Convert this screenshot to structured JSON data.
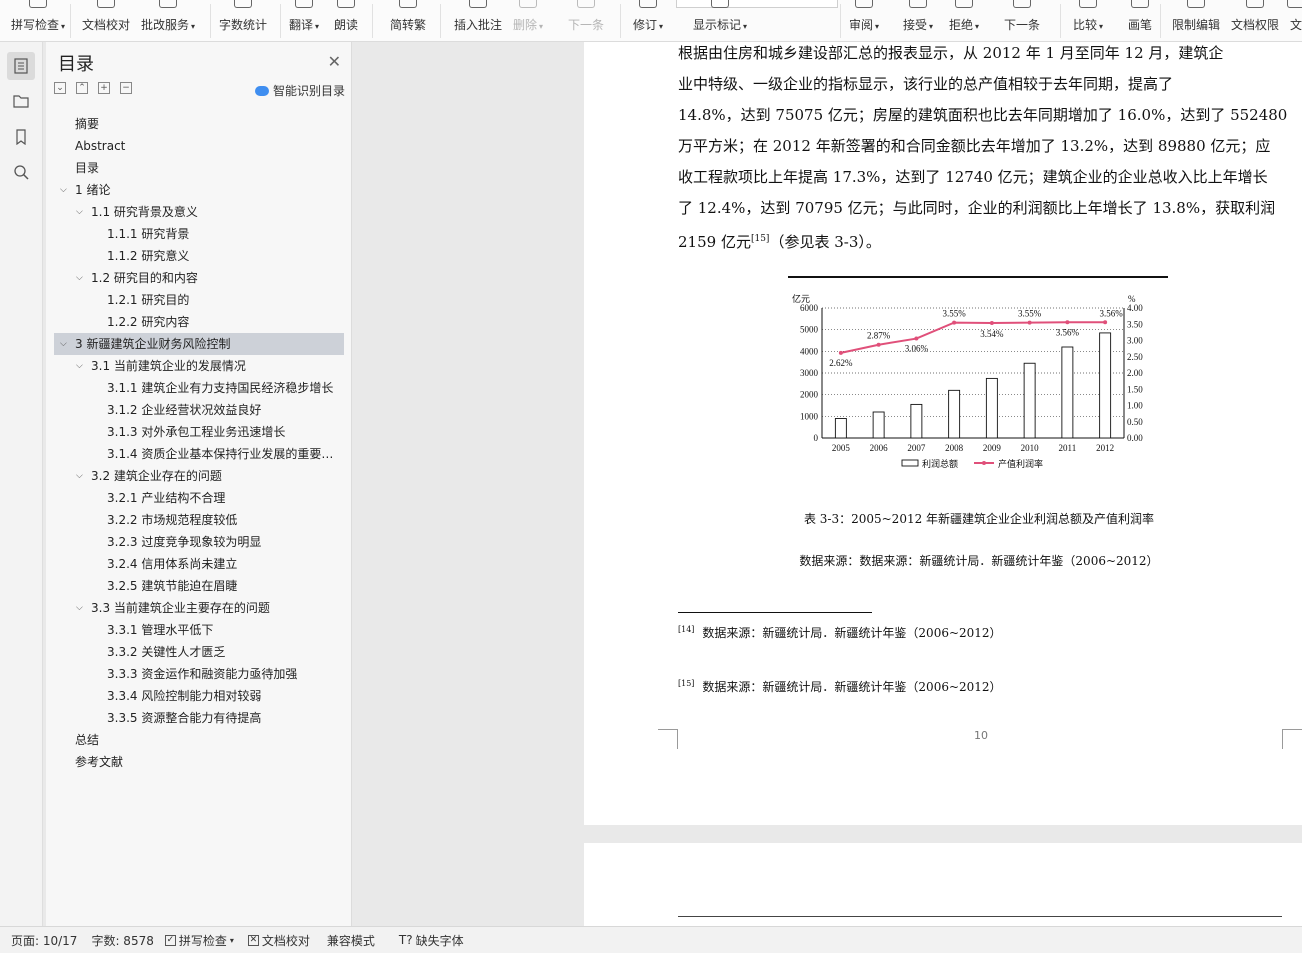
{
  "ribbon": {
    "items": [
      {
        "label": "拼写检查",
        "caret": true
      },
      {
        "label": "文档校对",
        "caret": false
      },
      {
        "label": "批改服务",
        "caret": true
      },
      {
        "label": "字数统计",
        "caret": false
      },
      {
        "label": "翻译",
        "caret": true
      },
      {
        "label": "朗读",
        "caret": false
      },
      {
        "label": "简转繁",
        "caret": false
      },
      {
        "label": "插入批注",
        "caret": false
      },
      {
        "label": "删除",
        "caret": true
      },
      {
        "label": "下一条",
        "caret": false
      },
      {
        "label": "修订",
        "caret": true
      },
      {
        "label": "显示标记",
        "caret": true
      },
      {
        "label": "审阅",
        "caret": true
      },
      {
        "label": "接受",
        "caret": true
      },
      {
        "label": "拒绝",
        "caret": true
      },
      {
        "label": "下一条",
        "caret": false
      },
      {
        "label": "比较",
        "caret": true
      },
      {
        "label": "画笔",
        "caret": false
      },
      {
        "label": "限制编辑",
        "caret": false
      },
      {
        "label": "文档权限",
        "caret": false
      },
      {
        "label": "文",
        "caret": false
      }
    ]
  },
  "toc": {
    "title": "目录",
    "smart_label": "智能识别目录",
    "items": [
      {
        "text": "摘要",
        "level": 0,
        "arrow": false
      },
      {
        "text": "Abstract",
        "level": 0,
        "arrow": false
      },
      {
        "text": "目录",
        "level": 0,
        "arrow": false
      },
      {
        "text": "1  绪论",
        "level": 1,
        "arrow": true
      },
      {
        "text": "1.1  研究背景及意义",
        "level": 2,
        "arrow": true
      },
      {
        "text": "1.1.1 研究背景",
        "level": 3,
        "arrow": false
      },
      {
        "text": "1.1.2 研究意义",
        "level": 3,
        "arrow": false
      },
      {
        "text": "1.2 研究目的和内容",
        "level": 2,
        "arrow": true
      },
      {
        "text": "1.2.1 研究目的",
        "level": 3,
        "arrow": false
      },
      {
        "text": "1.2.2 研究内容",
        "level": 3,
        "arrow": false
      },
      {
        "text": "3  新疆建筑企业财务风险控制",
        "level": 1,
        "arrow": true,
        "selected": true
      },
      {
        "text": "3.1  当前建筑企业的发展情况",
        "level": 2,
        "arrow": true
      },
      {
        "text": "3.1.1 建筑企业有力支持国民经济稳步增长",
        "level": 3,
        "arrow": false
      },
      {
        "text": "3.1.2 企业经营状况效益良好",
        "level": 3,
        "arrow": false
      },
      {
        "text": "3.1.3  对外承包工程业务迅速增长",
        "level": 3,
        "arrow": false
      },
      {
        "text": "3.1.4  资质企业基本保持行业发展的重要地位",
        "level": 3,
        "arrow": false
      },
      {
        "text": "3.2 建筑企业存在的问题",
        "level": 2,
        "arrow": true
      },
      {
        "text": "3.2.1 产业结构不合理",
        "level": 3,
        "arrow": false
      },
      {
        "text": "3.2.2 市场规范程度较低",
        "level": 3,
        "arrow": false
      },
      {
        "text": "3.2.3 过度竞争现象较为明显",
        "level": 3,
        "arrow": false
      },
      {
        "text": "3.2.4 信用体系尚未建立",
        "level": 3,
        "arrow": false
      },
      {
        "text": "3.2.5 建筑节能迫在眉睫",
        "level": 3,
        "arrow": false
      },
      {
        "text": "3.3 当前建筑企业主要存在的问题",
        "level": 2,
        "arrow": true
      },
      {
        "text": "3.3.1 管理水平低下",
        "level": 3,
        "arrow": false
      },
      {
        "text": "3.3.2 关键性人才匮乏",
        "level": 3,
        "arrow": false
      },
      {
        "text": "3.3.3 资金运作和融资能力亟待加强",
        "level": 3,
        "arrow": false
      },
      {
        "text": "3.3.4 风险控制能力相对较弱",
        "level": 3,
        "arrow": false
      },
      {
        "text": "3.3.5 资源整合能力有待提高",
        "level": 3,
        "arrow": false
      },
      {
        "text": "总结",
        "level": 0,
        "arrow": false
      },
      {
        "text": "参考文献",
        "level": 0,
        "arrow": false
      }
    ]
  },
  "document": {
    "lines": [
      "    根据由住房和城乡建设部汇总的报表显示，从 2012 年 1 月至同年 12 月，建筑企",
      "业中特级、一级企业的指标显示，该行业的总产值相较于去年同期，提高了",
      "14.8%，达到 75075 亿元；房屋的建筑面积也比去年同期增加了 16.0%，达到了 552480",
      "万平方米；在 2012 年新签署的和合同金额比去年增加了 13.2%，达到 89880 亿元；应",
      "收工程款项比上年提高 17.3%，达到了 12740 亿元；建筑企业的企业总收入比上年增长",
      "了 12.4%，达到 70795 亿元；与此同时，企业的利润额比上年增长了 13.8%，获取利润"
    ],
    "last_line_pre": "2159 亿元",
    "last_line_sup": "[15]",
    "last_line_post": "（参见表 3-3）。",
    "caption": "表 3-3：2005~2012 年新疆建筑企业企业利润总额及产值利润率",
    "source": "数据来源：数据来源：新疆统计局．新疆统计年鉴（2006~2012）",
    "footnotes": [
      {
        "mark": "[14]",
        "text": "数据来源：新疆统计局．新疆统计年鉴（2006~2012）"
      },
      {
        "mark": "[15]",
        "text": "数据来源：新疆统计局．新疆统计年鉴（2006~2012）"
      }
    ],
    "page_number": "10"
  },
  "chart_data": {
    "type": "bar",
    "categories": [
      "2005",
      "2006",
      "2007",
      "2008",
      "2009",
      "2010",
      "2011",
      "2012"
    ],
    "series": [
      {
        "name": "利润总额",
        "type": "bar",
        "axis": "left",
        "values": [
          900,
          1200,
          1550,
          2200,
          2750,
          3450,
          4200,
          4850
        ]
      },
      {
        "name": "产值利润率",
        "type": "line",
        "axis": "right",
        "values": [
          2.62,
          2.87,
          3.06,
          3.55,
          3.54,
          3.55,
          3.56,
          3.56
        ],
        "labels": [
          "2.62%",
          "2.87%",
          "3.06%",
          "3.55%",
          "3.54%",
          "3.55%",
          "3.56%",
          "3.56%"
        ],
        "color": "#e0507a"
      }
    ],
    "ylabel_left": "亿元",
    "ylabel_right": "%",
    "ylim_left": [
      0,
      6000
    ],
    "ylim_right": [
      0,
      4.0
    ],
    "yticks_left": [
      "0",
      "1000",
      "2000",
      "3000",
      "4000",
      "5000",
      "6000"
    ],
    "yticks_right": [
      "0.00",
      "0.50",
      "1.00",
      "1.50",
      "2.00",
      "2.50",
      "3.00",
      "3.50",
      "4.00"
    ],
    "grid": "dotted horizontal",
    "legend_position": "bottom"
  },
  "status": {
    "page": "页面: 10/17",
    "words": "字数: 8578",
    "spell": "拼写检查",
    "proof": "文档校对",
    "compat": "兼容模式",
    "font_missing": "缺失字体"
  }
}
